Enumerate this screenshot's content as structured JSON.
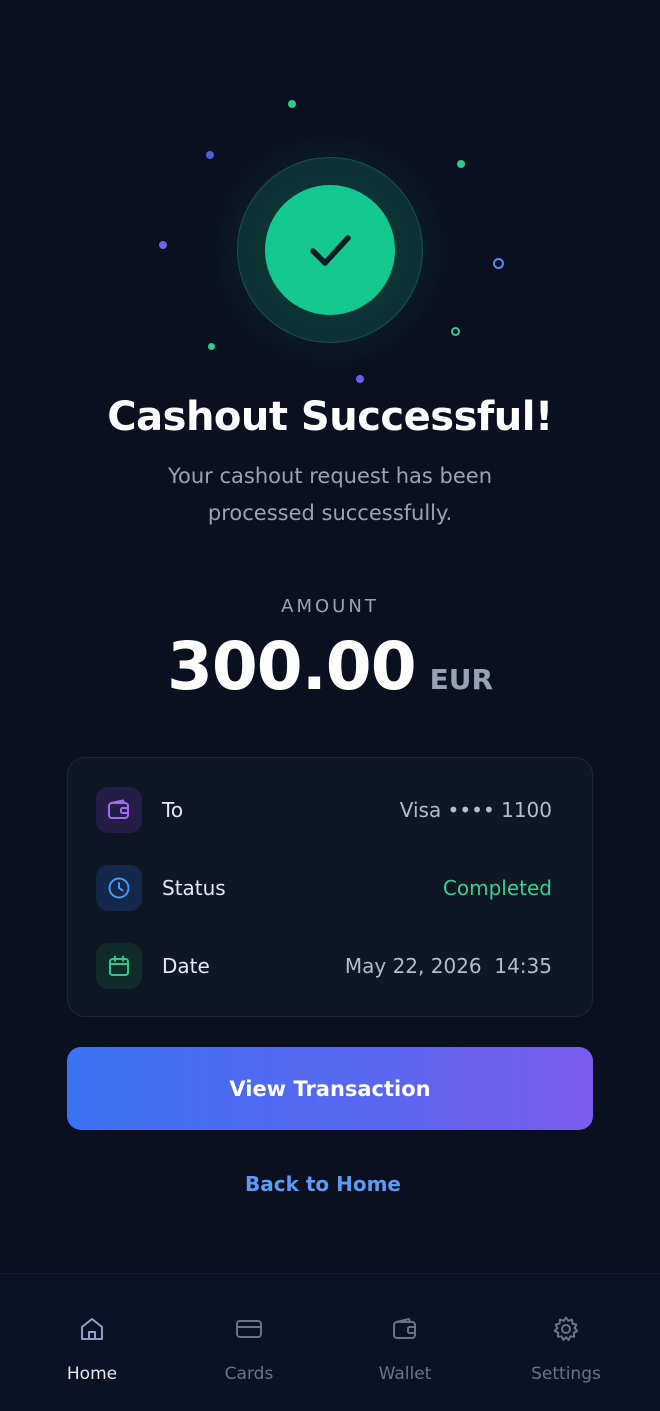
{
  "header": {
    "title": "Cashout Successful!",
    "subtitle": "Your cashout request has been processed successfully."
  },
  "amount": {
    "label": "AMOUNT",
    "value": "300.00",
    "currency": "EUR"
  },
  "details": [
    {
      "label": "To",
      "value": "Visa •••• 1100",
      "icon": "wallet-icon"
    },
    {
      "label": "Status",
      "value": "Completed",
      "icon": "clock-icon"
    },
    {
      "label": "Date",
      "value": "May 22, 2026  14:35",
      "icon": "calendar-icon"
    }
  ],
  "actions": {
    "primary_label": "View Transaction",
    "secondary_label": "Back to Home"
  },
  "nav": {
    "items": [
      {
        "label": "Home",
        "icon": "home-icon",
        "active": true
      },
      {
        "label": "Cards",
        "icon": "card-icon",
        "active": false
      },
      {
        "label": "Wallet",
        "icon": "wallet-icon",
        "active": false
      },
      {
        "label": "Settings",
        "icon": "gear-icon",
        "active": false
      }
    ]
  },
  "colors": {
    "background": "#0a1020",
    "success": "#14c98f",
    "status_text": "#2fd394",
    "accent_start": "#3b72f5",
    "accent_end": "#7b5cee",
    "link": "#5c9bf2"
  }
}
